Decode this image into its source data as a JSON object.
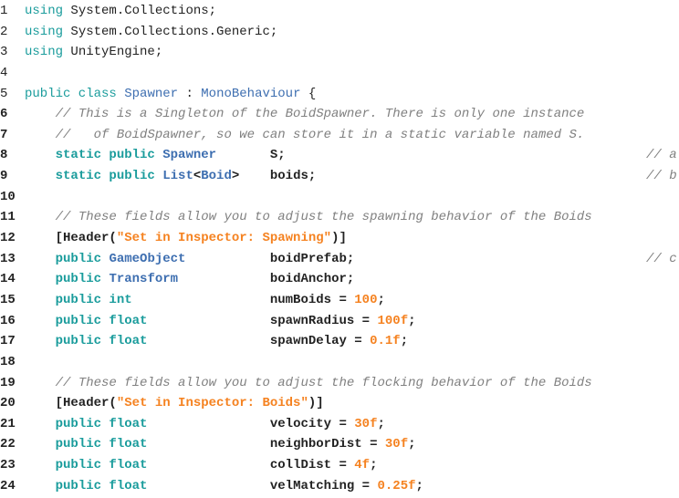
{
  "colors": {
    "keyword": "#1a9c9c",
    "type": "#3d6eb0",
    "literal": "#f58220",
    "comment": "#808080",
    "text": "#222222",
    "background": "#ffffff"
  },
  "lines": [
    {
      "n": "1",
      "tokens": [
        {
          "t": "kw",
          "v": "using"
        },
        {
          "t": "p",
          "v": " System.Collections;"
        }
      ]
    },
    {
      "n": "2",
      "tokens": [
        {
          "t": "kw",
          "v": "using"
        },
        {
          "t": "p",
          "v": " System.Collections.Generic;"
        }
      ]
    },
    {
      "n": "3",
      "tokens": [
        {
          "t": "kw",
          "v": "using"
        },
        {
          "t": "p",
          "v": " UnityEngine;"
        }
      ]
    },
    {
      "n": "4",
      "tokens": []
    },
    {
      "n": "5",
      "tokens": [
        {
          "t": "kw",
          "v": "public class"
        },
        {
          "t": "p",
          "v": " "
        },
        {
          "t": "ty",
          "v": "Spawner"
        },
        {
          "t": "p",
          "v": " : "
        },
        {
          "t": "ty",
          "v": "MonoBehaviour"
        },
        {
          "t": "p",
          "v": " {"
        }
      ]
    },
    {
      "n": "6",
      "tokens": [
        {
          "t": "p",
          "v": "    "
        },
        {
          "t": "cm",
          "v": "// This is a Singleton of the BoidSpawner. There is only one instance"
        }
      ]
    },
    {
      "n": "7",
      "tokens": [
        {
          "t": "p",
          "v": "    "
        },
        {
          "t": "cm",
          "v": "//   of BoidSpawner, so we can store it in a static variable named S."
        }
      ]
    },
    {
      "n": "8",
      "tokens": [
        {
          "t": "p",
          "v": "    "
        },
        {
          "t": "kw",
          "v": "static public"
        },
        {
          "t": "p",
          "v": " "
        },
        {
          "t": "ty",
          "v": "Spawner"
        },
        {
          "t": "p",
          "v": "       S;"
        }
      ],
      "right_comment": "// a"
    },
    {
      "n": "9",
      "tokens": [
        {
          "t": "p",
          "v": "    "
        },
        {
          "t": "kw",
          "v": "static public"
        },
        {
          "t": "p",
          "v": " "
        },
        {
          "t": "ty",
          "v": "List"
        },
        {
          "t": "p",
          "v": "<"
        },
        {
          "t": "ty",
          "v": "Boid"
        },
        {
          "t": "p",
          "v": ">    boids;"
        }
      ],
      "right_comment": "// b"
    },
    {
      "n": "10",
      "tokens": []
    },
    {
      "n": "11",
      "tokens": [
        {
          "t": "p",
          "v": "    "
        },
        {
          "t": "cm",
          "v": "// These fields allow you to adjust the spawning behavior of the Boids"
        }
      ]
    },
    {
      "n": "12",
      "tokens": [
        {
          "t": "p",
          "v": "    [Header("
        },
        {
          "t": "st",
          "v": "\"Set in Inspector: Spawning\""
        },
        {
          "t": "p",
          "v": ")]"
        }
      ]
    },
    {
      "n": "13",
      "tokens": [
        {
          "t": "p",
          "v": "    "
        },
        {
          "t": "kw",
          "v": "public"
        },
        {
          "t": "p",
          "v": " "
        },
        {
          "t": "ty",
          "v": "GameObject"
        },
        {
          "t": "p",
          "v": "           boidPrefab;"
        }
      ],
      "right_comment": "// c"
    },
    {
      "n": "14",
      "tokens": [
        {
          "t": "p",
          "v": "    "
        },
        {
          "t": "kw",
          "v": "public"
        },
        {
          "t": "p",
          "v": " "
        },
        {
          "t": "ty",
          "v": "Transform"
        },
        {
          "t": "p",
          "v": "            boidAnchor;"
        }
      ]
    },
    {
      "n": "15",
      "tokens": [
        {
          "t": "p",
          "v": "    "
        },
        {
          "t": "kw",
          "v": "public int"
        },
        {
          "t": "p",
          "v": "                  numBoids = "
        },
        {
          "t": "nu",
          "v": "100"
        },
        {
          "t": "p",
          "v": ";"
        }
      ]
    },
    {
      "n": "16",
      "tokens": [
        {
          "t": "p",
          "v": "    "
        },
        {
          "t": "kw",
          "v": "public float"
        },
        {
          "t": "p",
          "v": "                spawnRadius = "
        },
        {
          "t": "nu",
          "v": "100f"
        },
        {
          "t": "p",
          "v": ";"
        }
      ]
    },
    {
      "n": "17",
      "tokens": [
        {
          "t": "p",
          "v": "    "
        },
        {
          "t": "kw",
          "v": "public float"
        },
        {
          "t": "p",
          "v": "                spawnDelay = "
        },
        {
          "t": "nu",
          "v": "0.1f"
        },
        {
          "t": "p",
          "v": ";"
        }
      ]
    },
    {
      "n": "18",
      "tokens": []
    },
    {
      "n": "19",
      "tokens": [
        {
          "t": "p",
          "v": "    "
        },
        {
          "t": "cm",
          "v": "// These fields allow you to adjust the flocking behavior of the Boids"
        }
      ]
    },
    {
      "n": "20",
      "tokens": [
        {
          "t": "p",
          "v": "    [Header("
        },
        {
          "t": "st",
          "v": "\"Set in Inspector: Boids\""
        },
        {
          "t": "p",
          "v": ")]"
        }
      ]
    },
    {
      "n": "21",
      "tokens": [
        {
          "t": "p",
          "v": "    "
        },
        {
          "t": "kw",
          "v": "public float"
        },
        {
          "t": "p",
          "v": "                velocity = "
        },
        {
          "t": "nu",
          "v": "30f"
        },
        {
          "t": "p",
          "v": ";"
        }
      ]
    },
    {
      "n": "22",
      "tokens": [
        {
          "t": "p",
          "v": "    "
        },
        {
          "t": "kw",
          "v": "public float"
        },
        {
          "t": "p",
          "v": "                neighborDist = "
        },
        {
          "t": "nu",
          "v": "30f"
        },
        {
          "t": "p",
          "v": ";"
        }
      ]
    },
    {
      "n": "23",
      "tokens": [
        {
          "t": "p",
          "v": "    "
        },
        {
          "t": "kw",
          "v": "public float"
        },
        {
          "t": "p",
          "v": "                collDist = "
        },
        {
          "t": "nu",
          "v": "4f"
        },
        {
          "t": "p",
          "v": ";"
        }
      ]
    },
    {
      "n": "24",
      "tokens": [
        {
          "t": "p",
          "v": "    "
        },
        {
          "t": "kw",
          "v": "public float"
        },
        {
          "t": "p",
          "v": "                velMatching = "
        },
        {
          "t": "nu",
          "v": "0.25f"
        },
        {
          "t": "p",
          "v": ";"
        }
      ]
    }
  ]
}
